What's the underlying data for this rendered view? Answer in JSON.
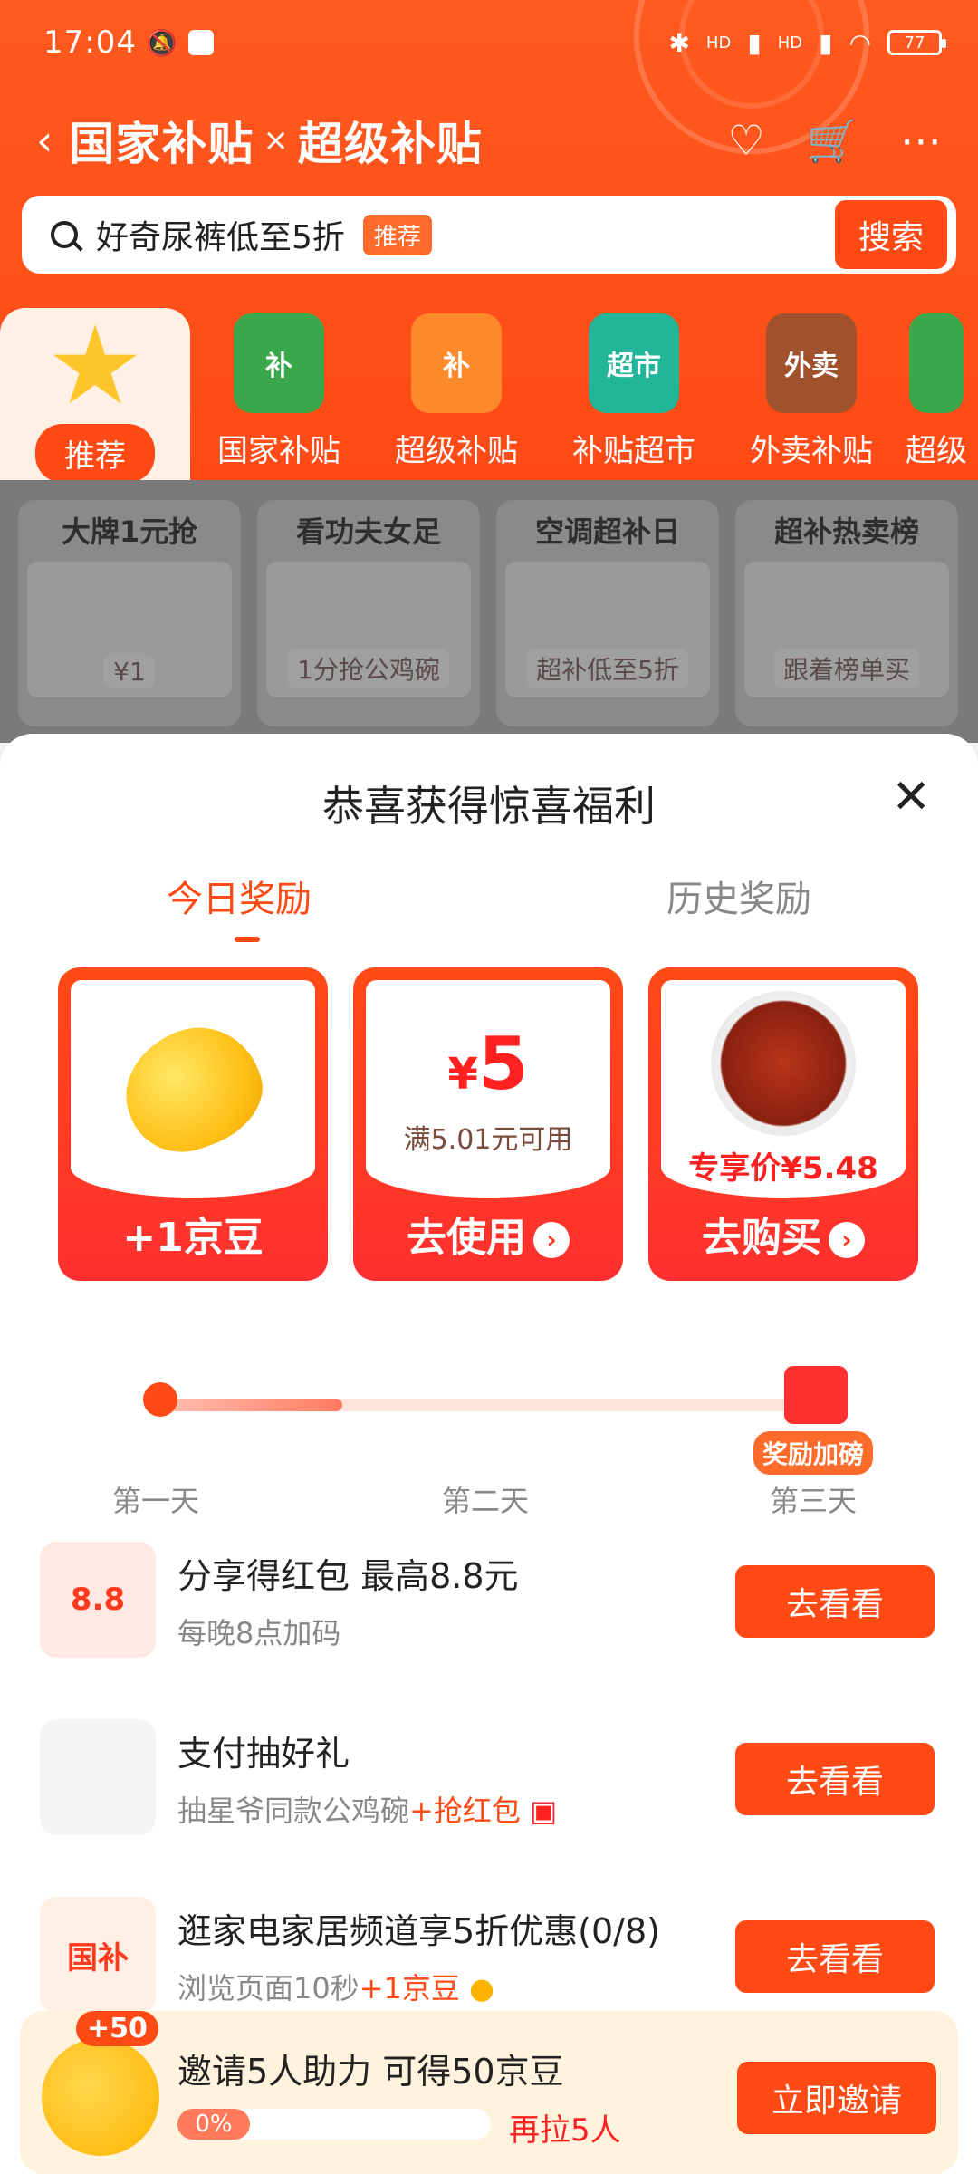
{
  "status": {
    "time": "17:04",
    "battery": "77",
    "signal1": "HD",
    "signal2": "HD"
  },
  "titlebar": {
    "title_left": "国家补贴",
    "title_sep": "×",
    "title_right": "超级补贴"
  },
  "search": {
    "value": "好奇尿裤低至5折",
    "tag": "推荐",
    "button": "搜索"
  },
  "categories": [
    {
      "label": "推荐",
      "active": true
    },
    {
      "label": "国家补贴",
      "icon_text": "补"
    },
    {
      "label": "超级补贴",
      "icon_text": "补"
    },
    {
      "label": "补贴超市",
      "icon_text": "超市"
    },
    {
      "label": "外卖补贴",
      "icon_text": "外卖"
    },
    {
      "label": "超级",
      "icon_text": ""
    }
  ],
  "promo_cards": [
    {
      "title": "大牌1元抢",
      "caption": "¥1"
    },
    {
      "title": "看功夫女足",
      "caption": "1分抢公鸡碗"
    },
    {
      "title": "空调超补日",
      "caption": "超补低至5折"
    },
    {
      "title": "超补热卖榜",
      "caption": "跟着榜单买"
    }
  ],
  "sheet": {
    "title": "恭喜获得惊喜福利",
    "tabs": {
      "active": "今日奖励",
      "other": "历史奖励"
    },
    "rewards": [
      {
        "action": "+1京豆"
      },
      {
        "price": "5",
        "currency": "¥",
        "note": "满5.01元可用",
        "action": "去使用"
      },
      {
        "exclusive": "专享价¥5.48",
        "action": "去购买"
      }
    ],
    "progress": {
      "days": [
        "第一天",
        "第二天",
        "第三天"
      ],
      "bonus_tag": "奖励加磅",
      "current_day": 1
    },
    "tasks": [
      {
        "title": "分享得红包 最高8.8元",
        "sub": "每晚8点加码",
        "sub_em": "",
        "button": "去看看",
        "thumb": "8.8"
      },
      {
        "title": "支付抽好礼",
        "sub": "抽星爷同款公鸡碗",
        "sub_em": "+抢红包",
        "button": "去看看",
        "thumb": ""
      },
      {
        "title": "逛家电家居频道享5折优惠(0/8)",
        "sub": "浏览页面10秒",
        "sub_em": "+1京豆",
        "button": "去看看",
        "thumb": "国补"
      }
    ],
    "invite": {
      "badge": "+50",
      "title": "邀请5人助力 可得50京豆",
      "percent": "0%",
      "remain": "再拉5人",
      "button": "立即邀请"
    }
  },
  "colors": {
    "accent": "#ff4a16",
    "price_red": "#ff2020"
  }
}
